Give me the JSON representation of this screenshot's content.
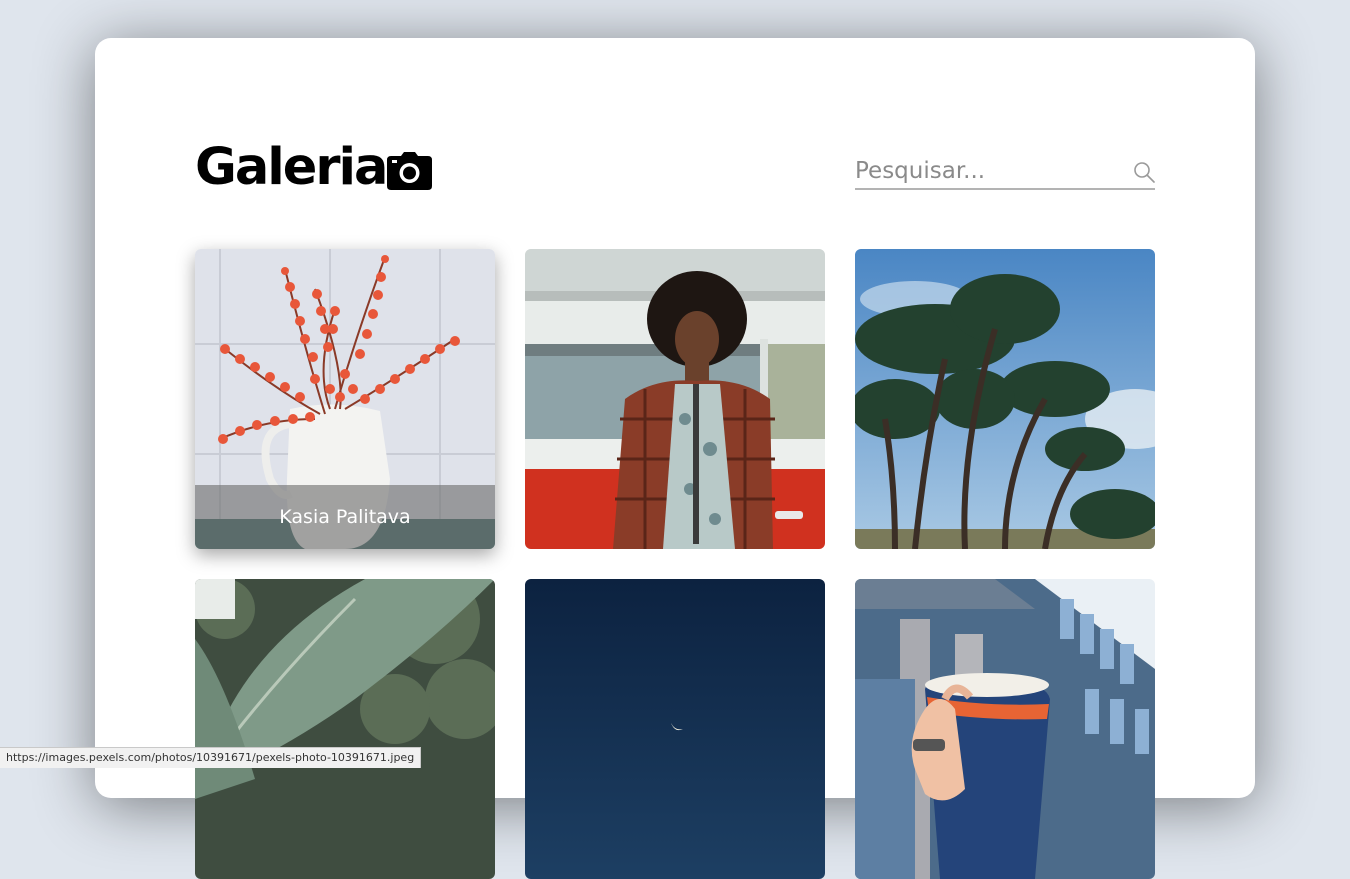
{
  "header": {
    "title": "Galeria",
    "title_icon": "camera-icon",
    "search": {
      "placeholder": "Pesquisar...",
      "value": "",
      "icon": "search-icon"
    }
  },
  "gallery": {
    "items": [
      {
        "subject": "red berries in white jug",
        "caption": "Kasia Palitava",
        "hovered": true
      },
      {
        "subject": "man in plaid jacket in front of red van",
        "hovered": false
      },
      {
        "subject": "cypress trees against blue sky",
        "hovered": false
      },
      {
        "subject": "banana leaf with green trees",
        "hovered": false
      },
      {
        "subject": "night sky with crescent moon",
        "hovered": false
      },
      {
        "subject": "hand holding coffee cup in front of building",
        "hovered": false
      }
    ]
  },
  "status_bar": {
    "url": "https://images.pexels.com/photos/10391671/pexels-photo-10391671.jpeg"
  },
  "colors": {
    "background": "#dfe5ed",
    "card": "#ffffff",
    "text": "#000000",
    "search_line": "#b3b3b3"
  }
}
